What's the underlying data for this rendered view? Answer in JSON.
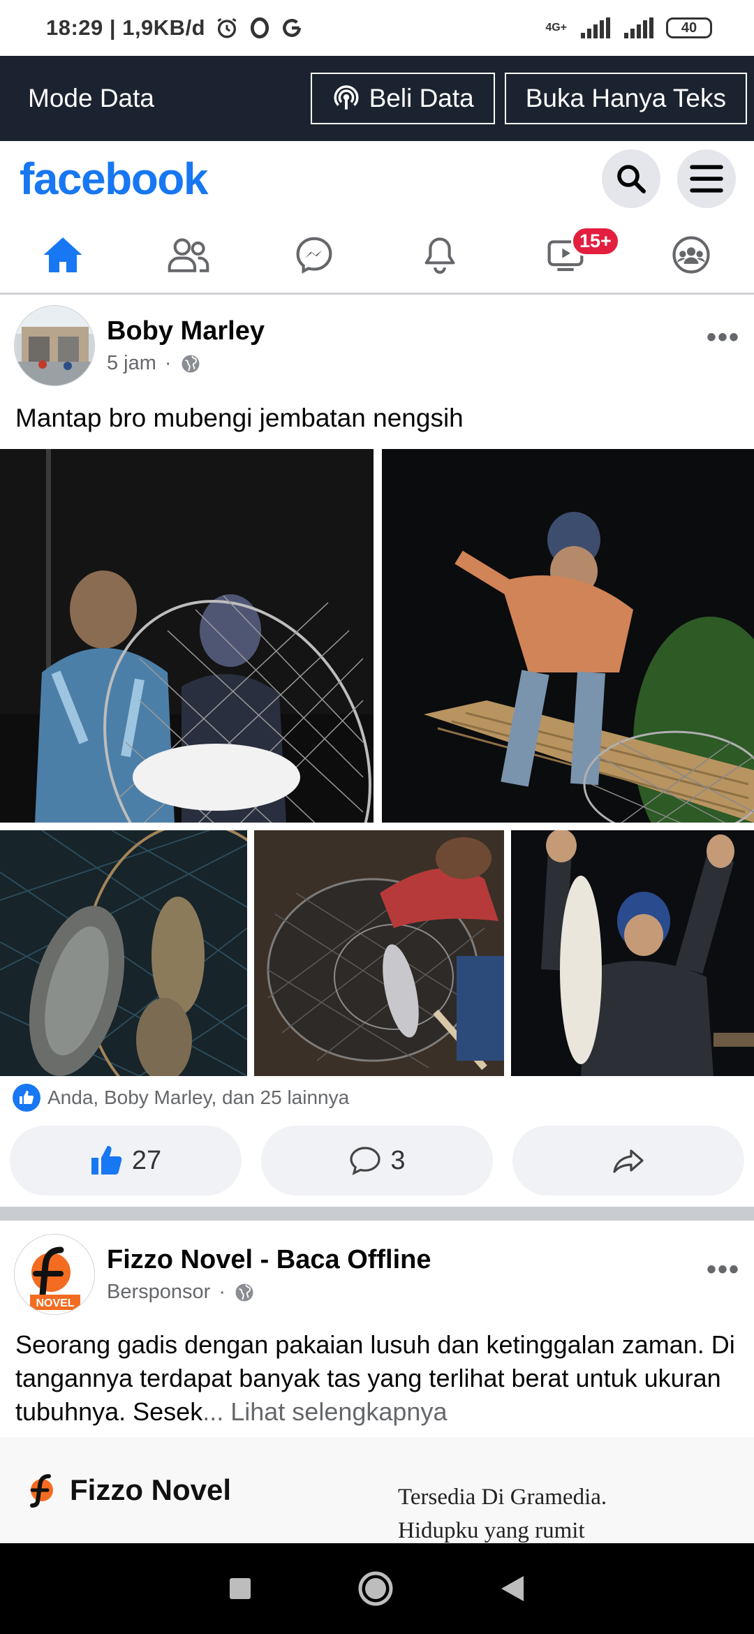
{
  "status_bar": {
    "time": "18:29",
    "speed": "1,9KB/d",
    "network": "4G+",
    "battery": "40"
  },
  "data_bar": {
    "mode_label": "Mode Data",
    "buy_label": "Beli Data",
    "text_only_label": "Buka Hanya Teks"
  },
  "header": {
    "logo": "facebook",
    "search_icon": "search-icon",
    "menu_icon": "hamburger-menu-icon",
    "accent": "#1877f2"
  },
  "tabs": [
    {
      "name": "home",
      "icon": "home-icon",
      "active": true
    },
    {
      "name": "friends",
      "icon": "friends-icon"
    },
    {
      "name": "messenger",
      "icon": "messenger-icon"
    },
    {
      "name": "notifications",
      "icon": "bell-icon"
    },
    {
      "name": "watch",
      "icon": "watch-icon",
      "badge": "15+"
    },
    {
      "name": "groups",
      "icon": "groups-icon"
    }
  ],
  "post": {
    "author": "Boby Marley",
    "time": "5 jam",
    "separator": "·",
    "text": "Mantap bro mubengi jembatan nengsih",
    "reactions_summary": "Anda, Boby Marley, dan 25 lainnya",
    "like_count": "27",
    "comment_count": "3"
  },
  "sponsored": {
    "name": "Fizzo Novel - Baca Offline",
    "label": "Bersponsor",
    "separator": "·",
    "avatar_text": "NOVEL",
    "text": "Seorang gadis dengan pakaian lusuh dan ketinggalan zaman. Di tangannya terdapat banyak tas yang terlihat berat untuk ukuran tubuhnya. Sesek",
    "ellipsis": "...",
    "see_more": "Lihat selengkapnya",
    "banner_brand": "Fizzo Novel",
    "banner_line1": "Tersedia Di Gramedia.",
    "banner_line2": "Hidupku yang rumit"
  }
}
